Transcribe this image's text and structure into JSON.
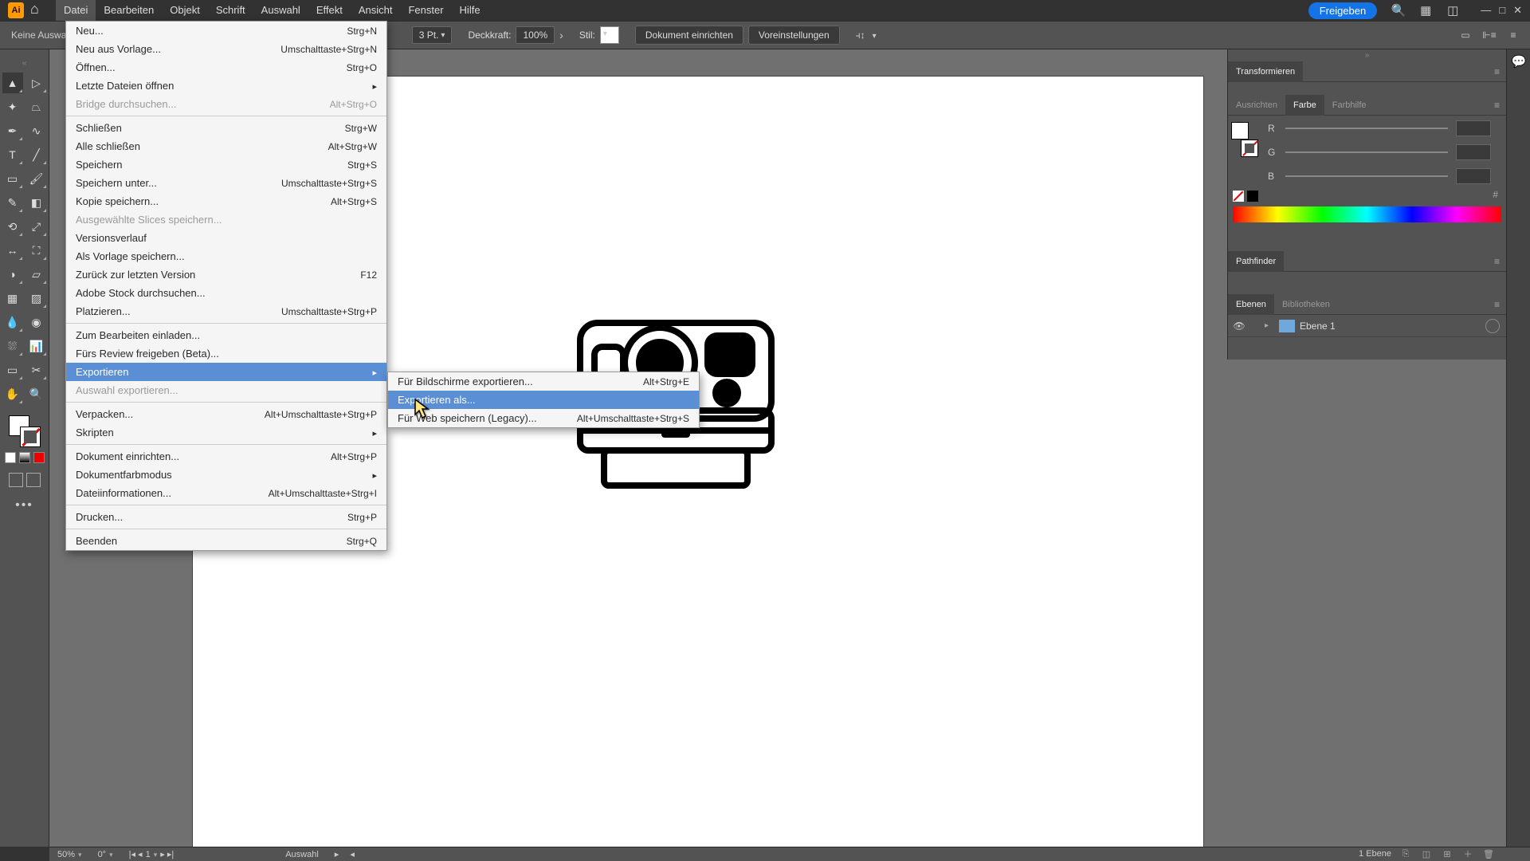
{
  "menubar": {
    "items": [
      "Datei",
      "Bearbeiten",
      "Objekt",
      "Schrift",
      "Auswahl",
      "Effekt",
      "Ansicht",
      "Fenster",
      "Hilfe"
    ],
    "active_index": 0,
    "share": "Freigeben"
  },
  "controlbar": {
    "selection": "Keine Auswahl",
    "stroke_pt": "3 Pt.",
    "opacity_label": "Deckkraft:",
    "opacity_value": "100%",
    "style_label": "Stil:",
    "doc_setup": "Dokument einrichten",
    "prefs": "Voreinstellungen"
  },
  "file_menu": [
    {
      "label": "Neu...",
      "shortcut": "Strg+N"
    },
    {
      "label": "Neu aus Vorlage...",
      "shortcut": "Umschalttaste+Strg+N"
    },
    {
      "label": "Öffnen...",
      "shortcut": "Strg+O"
    },
    {
      "label": "Letzte Dateien öffnen",
      "sub": true
    },
    {
      "label": "Bridge durchsuchen...",
      "shortcut": "Alt+Strg+O",
      "disabled": true
    },
    {
      "sep": true
    },
    {
      "label": "Schließen",
      "shortcut": "Strg+W"
    },
    {
      "label": "Alle schließen",
      "shortcut": "Alt+Strg+W"
    },
    {
      "label": "Speichern",
      "shortcut": "Strg+S"
    },
    {
      "label": "Speichern unter...",
      "shortcut": "Umschalttaste+Strg+S"
    },
    {
      "label": "Kopie speichern...",
      "shortcut": "Alt+Strg+S"
    },
    {
      "label": "Ausgewählte Slices speichern...",
      "disabled": true
    },
    {
      "label": "Versionsverlauf"
    },
    {
      "label": "Als Vorlage speichern..."
    },
    {
      "label": "Zurück zur letzten Version",
      "shortcut": "F12"
    },
    {
      "label": "Adobe Stock durchsuchen..."
    },
    {
      "label": "Platzieren...",
      "shortcut": "Umschalttaste+Strg+P"
    },
    {
      "sep": true
    },
    {
      "label": "Zum Bearbeiten einladen..."
    },
    {
      "label": "Fürs Review freigeben (Beta)..."
    },
    {
      "label": "Exportieren",
      "sub": true,
      "hl": true
    },
    {
      "label": "Auswahl exportieren...",
      "disabled": true
    },
    {
      "sep": true
    },
    {
      "label": "Verpacken...",
      "shortcut": "Alt+Umschalttaste+Strg+P"
    },
    {
      "label": "Skripten",
      "sub": true
    },
    {
      "sep": true
    },
    {
      "label": "Dokument einrichten...",
      "shortcut": "Alt+Strg+P"
    },
    {
      "label": "Dokumentfarbmodus",
      "sub": true
    },
    {
      "label": "Dateiinformationen...",
      "shortcut": "Alt+Umschalttaste+Strg+I"
    },
    {
      "sep": true
    },
    {
      "label": "Drucken...",
      "shortcut": "Strg+P"
    },
    {
      "sep": true
    },
    {
      "label": "Beenden",
      "shortcut": "Strg+Q"
    }
  ],
  "export_submenu": [
    {
      "label": "Für Bildschirme exportieren...",
      "shortcut": "Alt+Strg+E"
    },
    {
      "label": "Exportieren als...",
      "hl": true
    },
    {
      "label": "Für Web speichern (Legacy)...",
      "shortcut": "Alt+Umschalttaste+Strg+S"
    }
  ],
  "panels": {
    "transform": "Transformieren",
    "align": "Ausrichten",
    "color": "Farbe",
    "color_guide": "Farbhilfe",
    "pathfinder": "Pathfinder",
    "layers": "Ebenen",
    "libraries": "Bibliotheken",
    "r": "R",
    "g": "G",
    "b": "B",
    "hex": "#",
    "layer1": "Ebene 1"
  },
  "status": {
    "zoom": "50%",
    "rotation": "0°",
    "page": "1",
    "tool": "Auswahl",
    "layers_count": "1 Ebene"
  }
}
